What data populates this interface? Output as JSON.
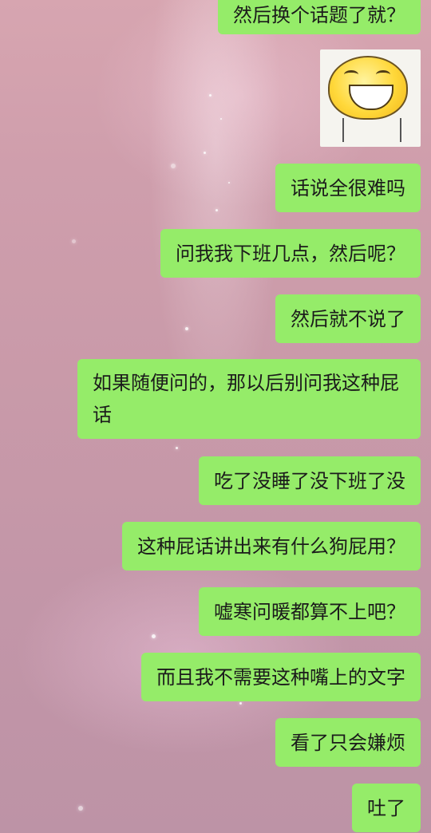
{
  "messages": [
    {
      "text": "然后换个话题了就？"
    },
    {
      "type": "sticker",
      "icon": "laughing-face-sticker"
    },
    {
      "text": "话说全很难吗"
    },
    {
      "text": "问我我下班几点，然后呢？"
    },
    {
      "text": "然后就不说了"
    },
    {
      "text": "如果随便问的，那以后别问我这种屁话"
    },
    {
      "text": "吃了没睡了没下班了没"
    },
    {
      "text": "这种屁话讲出来有什么狗屁用？"
    },
    {
      "text": "嘘寒问暖都算不上吧？"
    },
    {
      "text": "而且我不需要这种嘴上的文字"
    },
    {
      "text": "看了只会嫌烦"
    },
    {
      "text": "吐了"
    }
  ],
  "colors": {
    "bubble_bg": "#95ec69",
    "text": "#1b1b1b"
  }
}
